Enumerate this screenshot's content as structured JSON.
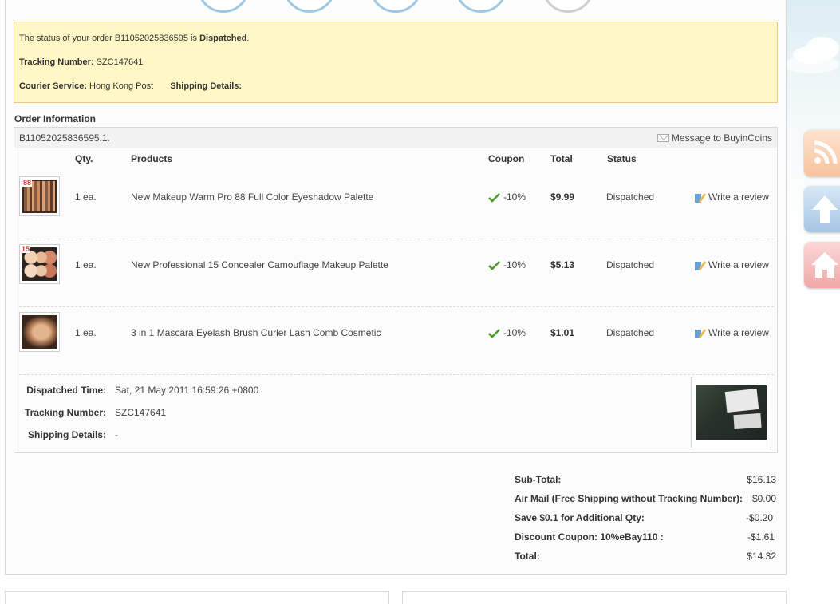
{
  "notice": {
    "status_prefix": "The status of your order B11052025836595 is ",
    "status_value": "Dispatched",
    "status_suffix": ".",
    "tracking_label": "Tracking Number:",
    "tracking_value": "SZC147641",
    "courier_label": "Courier Service:",
    "courier_value": "Hong Kong Post",
    "shipping_details_label": "Shipping Details:"
  },
  "order_info": {
    "title": "Order Information",
    "order_id": "B11052025836595.1.",
    "message_link": "Message to BuyinCoins",
    "columns": {
      "qty": "Qty.",
      "products": "Products",
      "coupon": "Coupon",
      "total": "Total",
      "status": "Status"
    },
    "items": [
      {
        "qty": "1 ea.",
        "product": "New Makeup Warm Pro 88 Full Color Eyeshadow Palette",
        "coupon": "-10%",
        "total": "$9.99",
        "status": "Dispatched",
        "review": "Write a review",
        "thumb_badge": "88"
      },
      {
        "qty": "1 ea.",
        "product": "New Professional 15 Concealer Camouflage Makeup Palette",
        "coupon": "-10%",
        "total": "$5.13",
        "status": "Dispatched",
        "review": "Write a review",
        "thumb_badge": "15"
      },
      {
        "qty": "1 ea.",
        "product": "3 in 1 Mascara Eyelash Brush Curler Lash Comb Cosmetic",
        "coupon": "-10%",
        "total": "$1.01",
        "status": "Dispatched",
        "review": "Write a review",
        "thumb_badge": ""
      }
    ],
    "shipment": {
      "dispatched_time_label": "Dispatched Time:",
      "dispatched_time_value": "Sat, 21 May 2011 16:59:26 +0800",
      "tracking_label": "Tracking Number:",
      "tracking_value": "SZC147641",
      "shipping_details_label": "Shipping Details:",
      "shipping_details_value": "-"
    }
  },
  "totals": {
    "subtotal_label": "Sub-Total:",
    "subtotal_value": "$16.13",
    "shipping_label": "Air Mail (Free Shipping without Tracking Number):",
    "shipping_value": "$0.00",
    "save_label": "Save $0.1 for Additional Qty:",
    "save_value": "-$0.20",
    "discount_label": "Discount Coupon: 10%eBay110 :",
    "discount_value": "-$1.61",
    "total_label": "Total:",
    "total_value": "$14.32"
  },
  "side_buttons": [
    {
      "icon": "rss-icon",
      "color": "#f9c9a5"
    },
    {
      "icon": "arrow-up-icon",
      "color": "#a9c9e6"
    },
    {
      "icon": "home-icon",
      "color": "#f3b3b3"
    }
  ],
  "colors": {
    "notice_bg": "#fff8c6",
    "notice_border": "#f1c88a",
    "check_green": "#4c9a2a"
  }
}
